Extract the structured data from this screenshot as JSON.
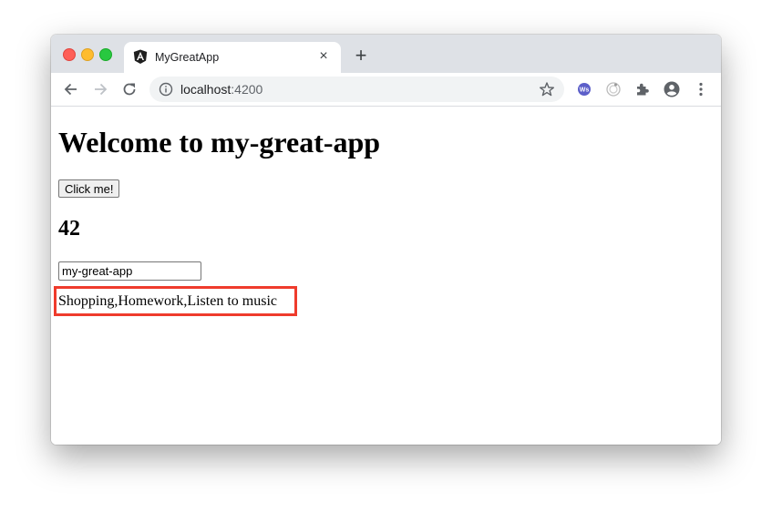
{
  "browser": {
    "tab": {
      "title": "MyGreatApp",
      "icon": "angular-logo-icon",
      "close_label": "×"
    },
    "new_tab_label": "+",
    "address": {
      "host": "localhost",
      "port": ":4200"
    },
    "nav": {
      "back": "back-arrow-icon",
      "forward": "forward-arrow-icon",
      "reload": "reload-icon"
    },
    "extensions": [
      "ws-extension-icon",
      "target-extension-icon",
      "puzzle-extensions-icon",
      "profile-avatar-icon",
      "more-menu-icon"
    ]
  },
  "page": {
    "heading": "Welcome to my-great-app",
    "button_label": "Click me!",
    "counter": "42",
    "input_value": "my-great-app",
    "items_text": "Shopping,Homework,Listen to music"
  },
  "colors": {
    "highlight_border": "#ef3b2c",
    "tabbar_bg": "#dee1e6"
  }
}
